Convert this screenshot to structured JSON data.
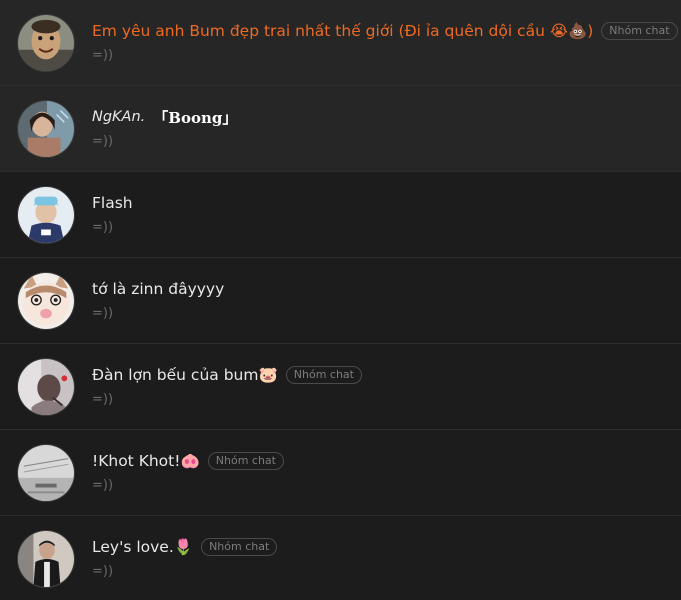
{
  "conversations": [
    {
      "name": "Em yêu anh Bum đẹp trai nhất thế giới (Đi ỉa quên dội cầu 😭💩)",
      "extra": "",
      "badge": "Nhóm chat",
      "preview": "=))",
      "highlight": true,
      "name_color": "#ee6a22"
    },
    {
      "name": "NgKAn.",
      "extra": "「Boong」",
      "badge": "",
      "preview": "=))",
      "highlight": true
    },
    {
      "name": "Flash",
      "extra": "",
      "badge": "",
      "preview": "=))",
      "highlight": false
    },
    {
      "name": "tớ là zinn đâyyyy",
      "extra": "",
      "badge": "",
      "preview": "=))",
      "highlight": false
    },
    {
      "name": "Đàn lợn bếu của bum🐷",
      "extra": "",
      "badge": "Nhóm chat",
      "preview": "=))",
      "highlight": false
    },
    {
      "name": "!Khot Khot!🐽",
      "extra": "",
      "badge": "Nhóm chat",
      "preview": "=))",
      "highlight": false
    },
    {
      "name": "Ley's love.🌷",
      "extra": "",
      "badge": "Nhóm chat",
      "preview": "=))",
      "highlight": false
    }
  ],
  "icons": {
    "avatar": "avatar-photo"
  }
}
